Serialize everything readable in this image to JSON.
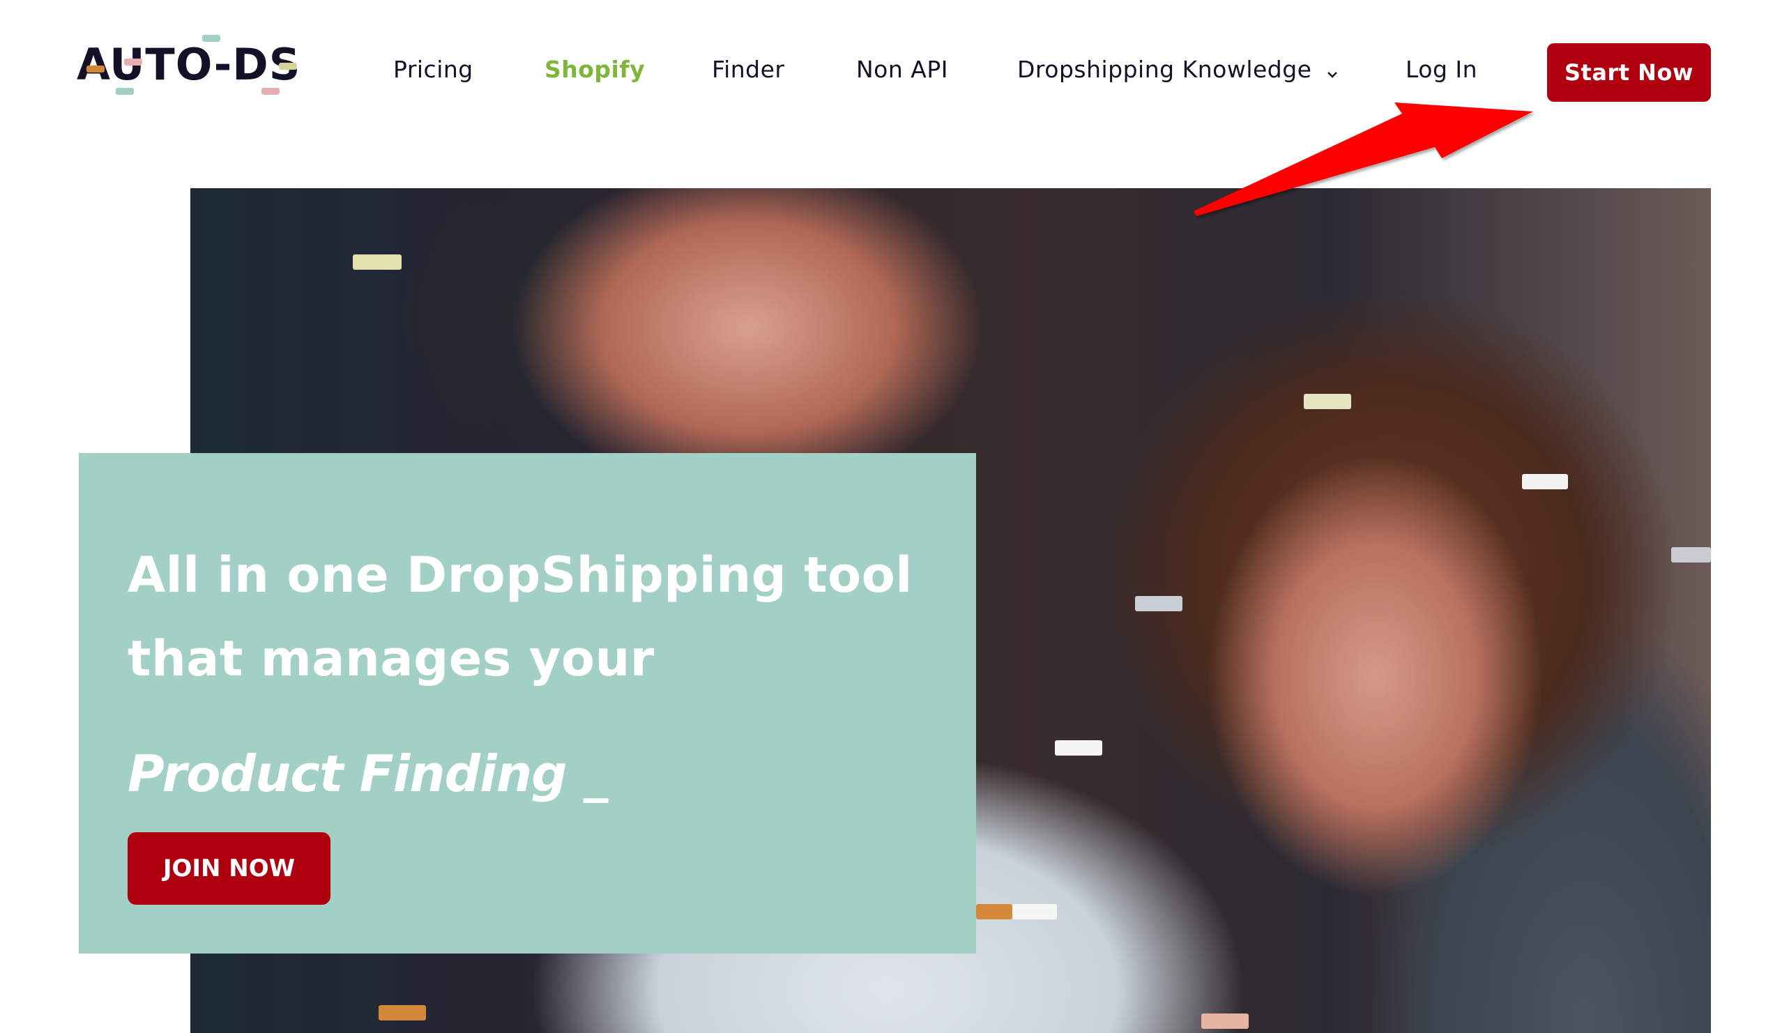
{
  "header": {
    "logo_text": "AUTO-DS",
    "nav": [
      {
        "label": "Pricing",
        "active": false
      },
      {
        "label": "Shopify",
        "active": true
      },
      {
        "label": "Finder",
        "active": false
      },
      {
        "label": "Non API",
        "active": false
      },
      {
        "label": "Dropshipping Knowledge",
        "active": false,
        "has_dropdown": true
      },
      {
        "label": "Log In",
        "active": false
      }
    ],
    "cta_label": "Start Now"
  },
  "hero": {
    "headline_line1": "All in one DropShipping tool",
    "headline_line2": "that manages your",
    "typed_text": "Product Finding",
    "typed_cursor": "_",
    "join_label": "JOIN NOW"
  },
  "annotation": {
    "type": "red-arrow",
    "points_to": "Start Now button"
  },
  "colors": {
    "brand_red": "#AF0010",
    "active_nav": "#7FB53A",
    "nav_text": "#131127",
    "hero_box": "#A3D0C5",
    "arrow": "#FF0000"
  }
}
